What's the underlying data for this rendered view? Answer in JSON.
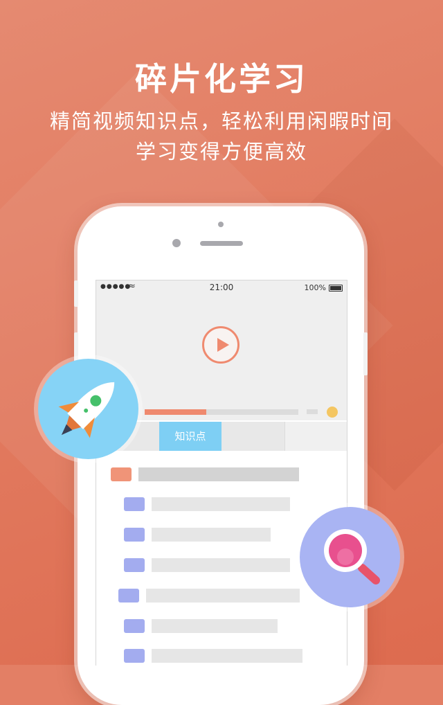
{
  "promo": {
    "headline": "碎片化学习",
    "subline1": "精简视频知识点，轻松利用闲暇时间",
    "subline2": "学习变得方便高效"
  },
  "status_bar": {
    "signal": "●●●●●",
    "time": "21:00",
    "battery": "100%"
  },
  "video": {
    "progress": 0.4
  },
  "tabs": [
    {
      "label": "知识点",
      "active": true
    },
    {
      "label": "",
      "active": false
    }
  ],
  "colors": {
    "background": "#e37f65",
    "accent_orange": "#ef8a6f",
    "tab_active": "#7ecff4",
    "item_icon": "#a3acef",
    "rocket_badge": "#86d3f6",
    "search_badge": "#a9b4f3"
  },
  "icons": {
    "rocket": "rocket-icon",
    "search": "magnifier-icon",
    "play": "play-icon"
  }
}
